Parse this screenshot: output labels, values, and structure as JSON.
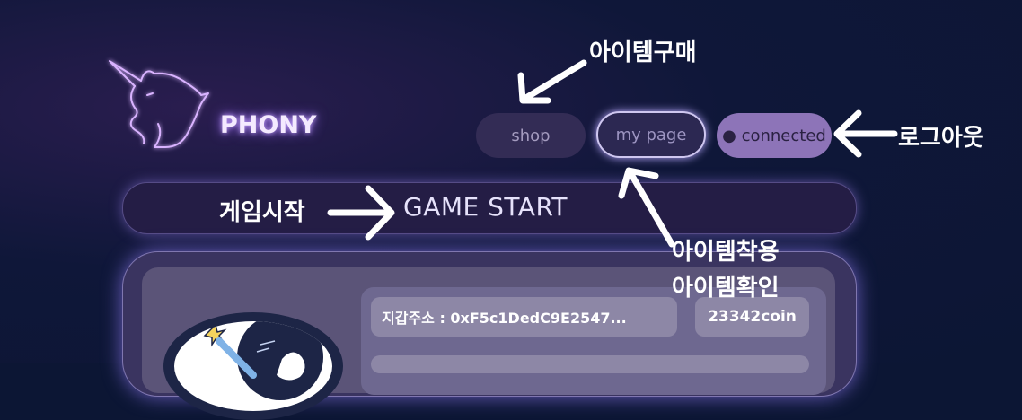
{
  "brand": {
    "name": "PHONY"
  },
  "nav": {
    "shop_label": "shop",
    "mypage_label": "my page",
    "connected_label": "● connected"
  },
  "game": {
    "start_label": "GAME START"
  },
  "profile": {
    "wallet_text": "지갑주소 : 0xF5c1DedC9E2547...",
    "coin_text": "23342coin"
  },
  "annotations": {
    "buy_items": "아이템구매",
    "logout": "로그아웃",
    "game_start": "게임시작",
    "equip_items": "아이템착용",
    "check_items": "아이템확인"
  },
  "colors": {
    "background": "#0c1634",
    "accent_purple": "#8d74b8",
    "panel": "#3a3460",
    "neon_glow": "#c7a5ff"
  },
  "icons": [
    "unicorn-logo-icon",
    "arrow-icon"
  ]
}
